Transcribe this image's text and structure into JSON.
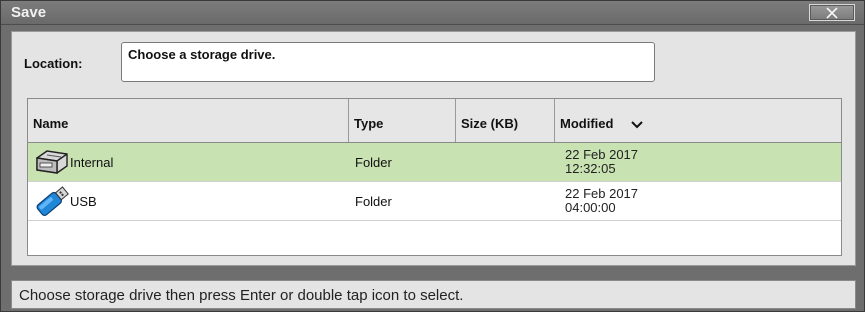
{
  "window": {
    "title": "Save",
    "close_icon": "close-x-icon"
  },
  "location": {
    "label": "Location:",
    "value": "Choose a storage drive."
  },
  "table": {
    "columns": [
      {
        "label": "Name"
      },
      {
        "label": "Type"
      },
      {
        "label": "Size (KB)"
      },
      {
        "label": "Modified",
        "sort": "descending"
      }
    ],
    "rows": [
      {
        "name": "Internal",
        "type": "Folder",
        "size": "",
        "date": "22 Feb 2017",
        "time": "12:32:05",
        "icon": "hard-drive-icon",
        "selected": true
      },
      {
        "name": "USB",
        "type": "Folder",
        "size": "",
        "date": "22 Feb 2017",
        "time": "04:00:00",
        "icon": "usb-drive-icon",
        "selected": false
      }
    ]
  },
  "status": {
    "text": "Choose storage drive then press Enter or double tap icon to select."
  },
  "colors": {
    "selected_row": "#c9e2b2",
    "window_frame": "#6e6e6e",
    "panel": "#e4e4e4"
  }
}
